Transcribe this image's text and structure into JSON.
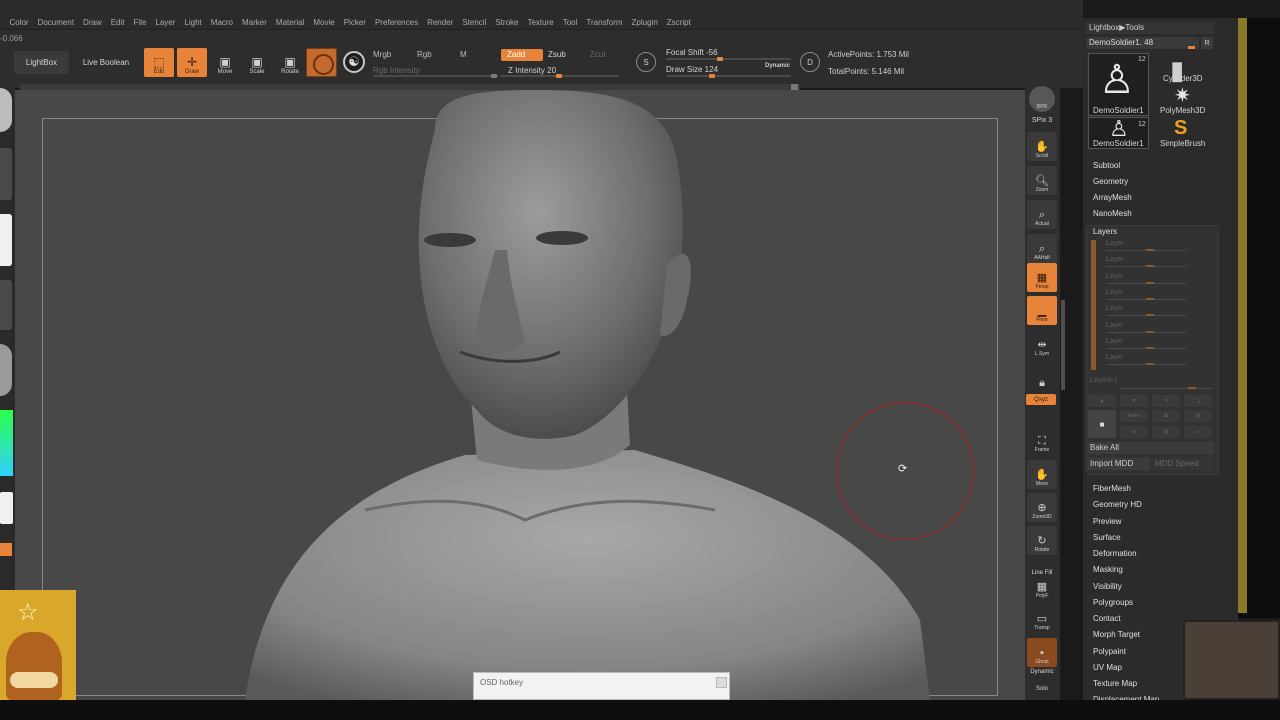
{
  "menubar": {
    "items": [
      "h",
      "Color",
      "Document",
      "Draw",
      "Edit",
      "File",
      "Layer",
      "Light",
      "Macro",
      "Marker",
      "Material",
      "Movie",
      "Picker",
      "Preferences",
      "Render",
      "Stencil",
      "Stroke",
      "Texture",
      "Tool",
      "Transform",
      "Zplugin",
      "Zscript"
    ]
  },
  "coord_readout": "-0.066",
  "toolbar": {
    "lightbox": "LightBox",
    "live_boolean": "Live Boolean",
    "edit": "Edit",
    "draw": "Draw",
    "move": "Move",
    "scale": "Scale",
    "rotate": "Rotate",
    "mrgb": "Mrgb",
    "rgb": "Rgb",
    "m": "M",
    "zadd": "Zadd",
    "zsub": "Zsub",
    "zcut": "Zcut",
    "rgb_intensity": "Rgb Intensity",
    "z_intensity": "Z Intensity 20",
    "focal_shift": "Focal Shift -56",
    "draw_size": "Draw Size 124",
    "dynamic": "Dynamic",
    "active_points": "ActivePoints: 1.753 Mil",
    "total_points": "TotalPoints: 5.146 Mil",
    "s_icon": "S",
    "d_icon": "D"
  },
  "viewport": {
    "osd_title": "OSD hotkey"
  },
  "right_shelf": {
    "bpr": "BPR",
    "spix": "SPix 3",
    "scroll": "Scroll",
    "zoom": "Zoom",
    "actual": "Actual",
    "aahalf": "AAHalf",
    "persp": "Persp",
    "floor": "Floor",
    "lsym": "L.Sym",
    "lock": "",
    "xyz": "Qxyz",
    "frame": "Frame",
    "move": "Move",
    "zoom3d": "Zoom3D",
    "rotate": "Rotate",
    "line_fill": "Line Fill",
    "polyf": "PolyF",
    "transp": "Transp",
    "ghost": "Ghost",
    "dynamic": "Dynamic",
    "solo": "Solo"
  },
  "right_panel": {
    "title": "Lightbox▶Tools",
    "tool_slider": "DemoSoldier1. 48",
    "r_button": "R",
    "thumbs": [
      {
        "label": "DemoSoldier1",
        "count": "12"
      },
      {
        "label": "Cylinder3D",
        "count": ""
      },
      {
        "label": "PolyMesh3D",
        "count": ""
      },
      {
        "label": "DemoSoldier1",
        "count": "12"
      },
      {
        "label": "SimpleBrush",
        "count": ""
      }
    ],
    "sections_top": [
      "Subtool",
      "Geometry",
      "ArrayMesh",
      "NanoMesh"
    ],
    "layers_title": "Layers",
    "layers": [
      "Layer",
      "Layer",
      "Layer",
      "Layer",
      "Layer",
      "Layer",
      "Layer",
      "Layer"
    ],
    "layer_zero": "Layer0-1",
    "name_label": "Name",
    "bake_all": "Bake All",
    "import_mdd": "Import MDD",
    "mdd_speed": "MDD Speed",
    "sections_bottom": [
      "FiberMesh",
      "Geometry HD",
      "Preview",
      "Surface",
      "Deformation",
      "Masking",
      "Visibility",
      "Polygroups",
      "Contact",
      "Morph Target",
      "Polypaint",
      "UV Map",
      "Texture Map",
      "Displacement Map"
    ]
  },
  "colors": {
    "accent": "#e8843a",
    "viewport_bg": "#484848",
    "panel_bg": "#2b2b2b",
    "brush_ring": "#b02020"
  }
}
